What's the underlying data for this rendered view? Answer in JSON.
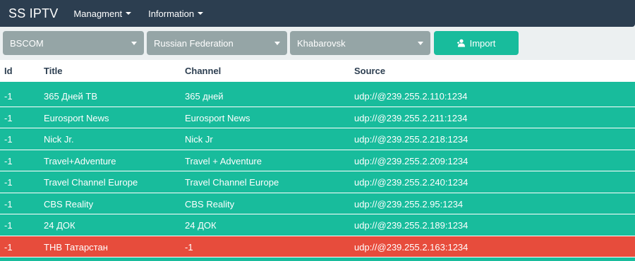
{
  "navbar": {
    "brand": "SS IPTV",
    "menu": [
      {
        "label": "Managment"
      },
      {
        "label": "Information"
      }
    ]
  },
  "filters": {
    "provider": "BSCOM",
    "country": "Russian Federation",
    "city": "Khabarovsk",
    "import_label": "Import"
  },
  "table": {
    "headers": {
      "id": "Id",
      "title": "Title",
      "channel": "Channel",
      "source": "Source"
    },
    "rows": [
      {
        "id": "-1",
        "title": "365 Дней ТВ",
        "channel": "365 дней",
        "source": "udp://@239.255.2.110:1234",
        "status": "ok"
      },
      {
        "id": "-1",
        "title": "Eurosport News",
        "channel": "Eurosport News",
        "source": "udp://@239.255.2.211:1234",
        "status": "ok"
      },
      {
        "id": "-1",
        "title": "Nick Jr.",
        "channel": "Nick Jr",
        "source": "udp://@239.255.2.218:1234",
        "status": "ok"
      },
      {
        "id": "-1",
        "title": "Travel+Adventure",
        "channel": "Travel + Adventure",
        "source": "udp://@239.255.2.209:1234",
        "status": "ok"
      },
      {
        "id": "-1",
        "title": "Travel Channel Europe",
        "channel": "Travel Channel Europe",
        "source": "udp://@239.255.2.240:1234",
        "status": "ok"
      },
      {
        "id": "-1",
        "title": "CBS Reality",
        "channel": "CBS Reality",
        "source": "udp://@239.255.2.95:1234",
        "status": "ok"
      },
      {
        "id": "-1",
        "title": "24 ДОК",
        "channel": "24 ДОК",
        "source": "udp://@239.255.2.189:1234",
        "status": "ok"
      },
      {
        "id": "-1",
        "title": "ТНВ Татарстан",
        "channel": "-1",
        "source": "udp://@239.255.2.163:1234",
        "status": "error"
      }
    ]
  },
  "colors": {
    "navbar": "#2c3e50",
    "select": "#95a5a6",
    "success": "#18bc9c",
    "danger": "#e74c3c"
  },
  "icons": {
    "import": "user-plus-icon",
    "dropdown": "caret-down-icon"
  }
}
